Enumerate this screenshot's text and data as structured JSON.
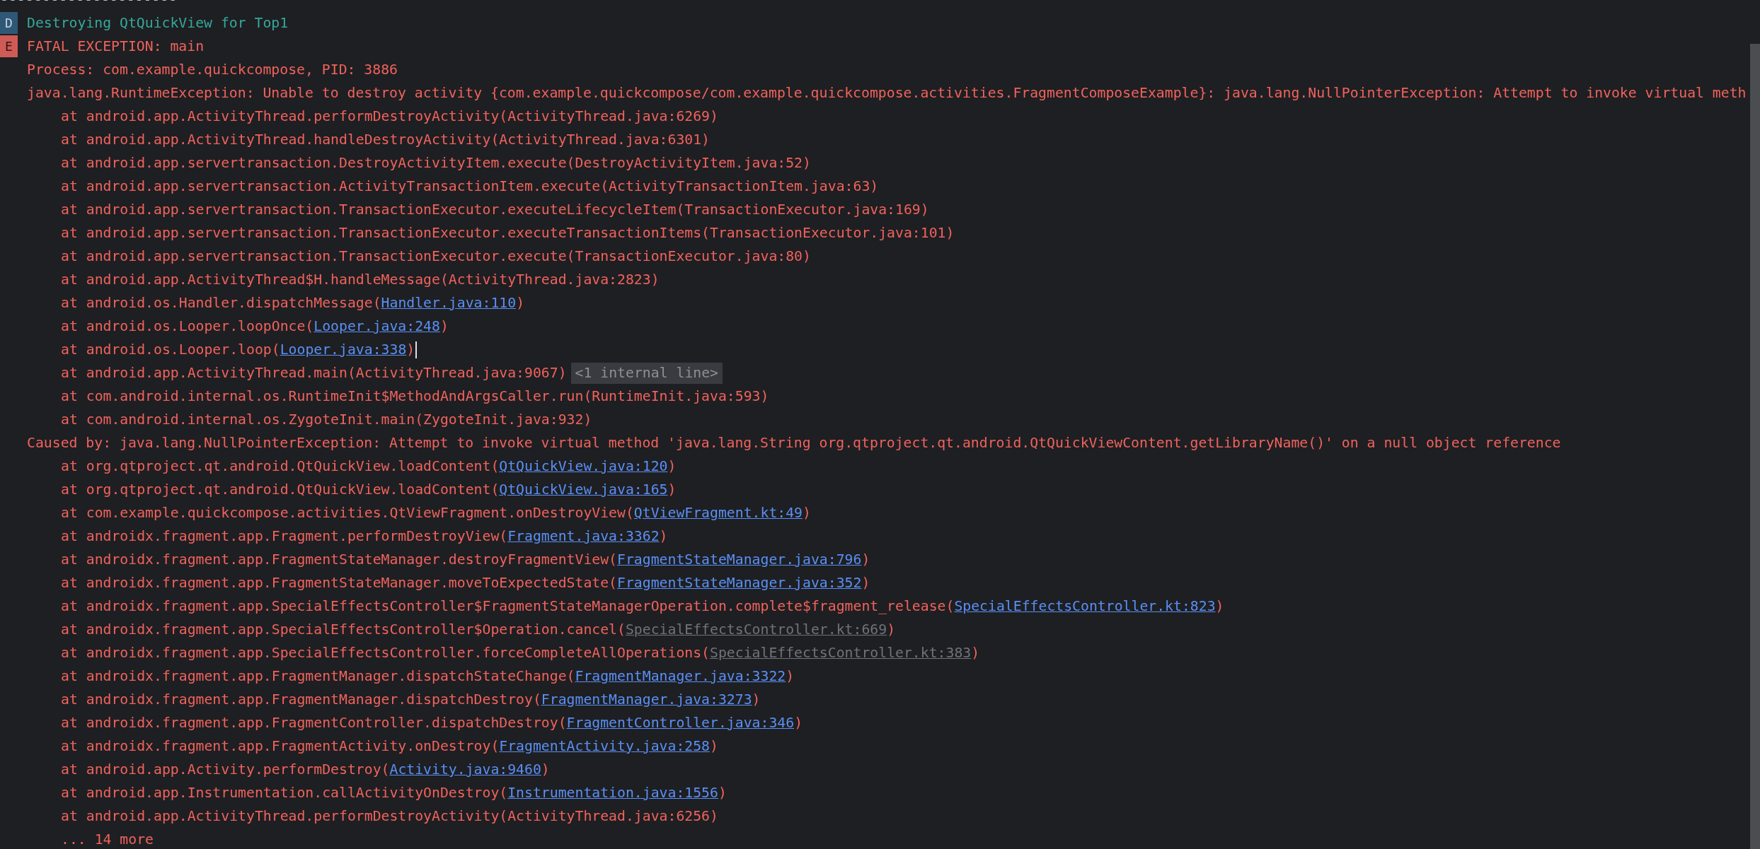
{
  "separator": "---------------------",
  "lines": [
    {
      "kind": "debug",
      "tag": "D",
      "text": "Destroying QtQuickView for Top1"
    },
    {
      "kind": "error",
      "tag": "E",
      "text": "FATAL EXCEPTION: main"
    },
    {
      "kind": "error",
      "text": "Process: com.example.quickcompose, PID: 3886"
    },
    {
      "kind": "error",
      "text": "java.lang.RuntimeException: Unable to destroy activity {com.example.quickcompose/com.example.quickcompose.activities.FragmentComposeExample}: java.lang.NullPointerException: Attempt to invoke virtual meth"
    },
    {
      "kind": "frame",
      "text": "at android.app.ActivityThread.performDestroyActivity(ActivityThread.java:6269)"
    },
    {
      "kind": "frame",
      "text": "at android.app.ActivityThread.handleDestroyActivity(ActivityThread.java:6301)"
    },
    {
      "kind": "frame",
      "text": "at android.app.servertransaction.DestroyActivityItem.execute(DestroyActivityItem.java:52)"
    },
    {
      "kind": "frame",
      "text": "at android.app.servertransaction.ActivityTransactionItem.execute(ActivityTransactionItem.java:63)"
    },
    {
      "kind": "frame",
      "text": "at android.app.servertransaction.TransactionExecutor.executeLifecycleItem(TransactionExecutor.java:169)"
    },
    {
      "kind": "frame",
      "text": "at android.app.servertransaction.TransactionExecutor.executeTransactionItems(TransactionExecutor.java:101)"
    },
    {
      "kind": "frame",
      "text": "at android.app.servertransaction.TransactionExecutor.execute(TransactionExecutor.java:80)"
    },
    {
      "kind": "frame",
      "text": "at android.app.ActivityThread$H.handleMessage(ActivityThread.java:2823)"
    },
    {
      "kind": "frame",
      "text": "at android.os.Handler.dispatchMessage(",
      "link": "Handler.java:110",
      "link_muted": false,
      "after": ")"
    },
    {
      "kind": "frame",
      "text": "at android.os.Looper.loopOnce(",
      "link": "Looper.java:248",
      "link_muted": false,
      "after": ")"
    },
    {
      "kind": "frame",
      "text": "at android.os.Looper.loop(",
      "link": "Looper.java:338",
      "link_muted": false,
      "after": ")",
      "caret": true
    },
    {
      "kind": "frame",
      "text": "at android.app.ActivityThread.main(ActivityThread.java:9067)",
      "folded": "<1 internal line>"
    },
    {
      "kind": "frame",
      "text": "at com.android.internal.os.RuntimeInit$MethodAndArgsCaller.run(RuntimeInit.java:593)"
    },
    {
      "kind": "frame",
      "text": "at com.android.internal.os.ZygoteInit.main(ZygoteInit.java:932)"
    },
    {
      "kind": "error",
      "text": "Caused by: java.lang.NullPointerException: Attempt to invoke virtual method 'java.lang.String org.qtproject.qt.android.QtQuickViewContent.getLibraryName()' on a null object reference"
    },
    {
      "kind": "frame",
      "text": "at org.qtproject.qt.android.QtQuickView.loadContent(",
      "link": "QtQuickView.java:120",
      "link_muted": false,
      "after": ")"
    },
    {
      "kind": "frame",
      "text": "at org.qtproject.qt.android.QtQuickView.loadContent(",
      "link": "QtQuickView.java:165",
      "link_muted": false,
      "after": ")"
    },
    {
      "kind": "frame",
      "text": "at com.example.quickcompose.activities.QtViewFragment.onDestroyView(",
      "link": "QtViewFragment.kt:49",
      "link_muted": false,
      "after": ")"
    },
    {
      "kind": "frame",
      "text": "at androidx.fragment.app.Fragment.performDestroyView(",
      "link": "Fragment.java:3362",
      "link_muted": false,
      "after": ")"
    },
    {
      "kind": "frame",
      "text": "at androidx.fragment.app.FragmentStateManager.destroyFragmentView(",
      "link": "FragmentStateManager.java:796",
      "link_muted": false,
      "after": ")"
    },
    {
      "kind": "frame",
      "text": "at androidx.fragment.app.FragmentStateManager.moveToExpectedState(",
      "link": "FragmentStateManager.java:352",
      "link_muted": false,
      "after": ")"
    },
    {
      "kind": "frame",
      "text": "at androidx.fragment.app.SpecialEffectsController$FragmentStateManagerOperation.complete$fragment_release(",
      "link": "SpecialEffectsController.kt:823",
      "link_muted": false,
      "after": ")"
    },
    {
      "kind": "frame",
      "text": "at androidx.fragment.app.SpecialEffectsController$Operation.cancel(",
      "link": "SpecialEffectsController.kt:669",
      "link_muted": true,
      "after": ")"
    },
    {
      "kind": "frame",
      "text": "at androidx.fragment.app.SpecialEffectsController.forceCompleteAllOperations(",
      "link": "SpecialEffectsController.kt:383",
      "link_muted": true,
      "after": ")"
    },
    {
      "kind": "frame",
      "text": "at androidx.fragment.app.FragmentManager.dispatchStateChange(",
      "link": "FragmentManager.java:3322",
      "link_muted": false,
      "after": ")"
    },
    {
      "kind": "frame",
      "text": "at androidx.fragment.app.FragmentManager.dispatchDestroy(",
      "link": "FragmentManager.java:3273",
      "link_muted": false,
      "after": ")"
    },
    {
      "kind": "frame",
      "text": "at androidx.fragment.app.FragmentController.dispatchDestroy(",
      "link": "FragmentController.java:346",
      "link_muted": false,
      "after": ")"
    },
    {
      "kind": "frame",
      "text": "at androidx.fragment.app.FragmentActivity.onDestroy(",
      "link": "FragmentActivity.java:258",
      "link_muted": false,
      "after": ")"
    },
    {
      "kind": "frame",
      "text": "at android.app.Activity.performDestroy(",
      "link": "Activity.java:9460",
      "link_muted": false,
      "after": ")"
    },
    {
      "kind": "frame",
      "text": "at android.app.Instrumentation.callActivityOnDestroy(",
      "link": "Instrumentation.java:1556",
      "link_muted": false,
      "after": ")"
    },
    {
      "kind": "frame",
      "text": "at android.app.ActivityThread.performDestroyActivity(ActivityThread.java:6256)"
    },
    {
      "kind": "frame",
      "text": "... 14 more"
    }
  ]
}
